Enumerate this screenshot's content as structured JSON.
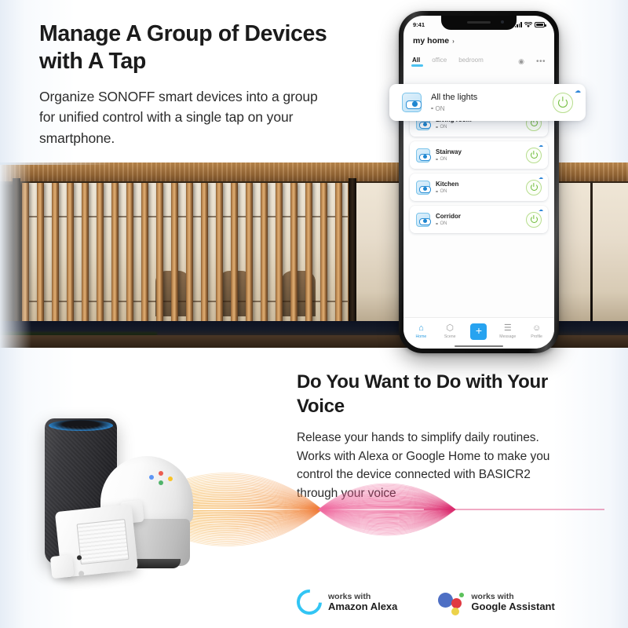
{
  "section1": {
    "heading": "Manage A Group of Devices with A Tap",
    "body": "Organize SONOFF smart devices into a group for unified control with a single tap on your smartphone."
  },
  "phone": {
    "status_bar": {
      "time": "9:41",
      "signal_icon": "signal-bars-icon",
      "wifi_icon": "wifi-icon",
      "battery_icon": "battery-full-icon"
    },
    "home_title": "my home",
    "home_chevron": "›",
    "tabs": [
      {
        "label": "All",
        "active": true
      },
      {
        "label": "office",
        "active": false
      },
      {
        "label": "bedroom",
        "active": false
      }
    ],
    "tab_actions": {
      "eye_icon": "◉",
      "more_icon": "•••"
    },
    "devices": [
      {
        "name": "Living room",
        "state": "ON"
      },
      {
        "name": "Stairway",
        "state": "ON"
      },
      {
        "name": "Kitchen",
        "state": "ON"
      },
      {
        "name": "Corridor",
        "state": "ON"
      }
    ],
    "bottom_nav": [
      {
        "label": "Home",
        "glyph": "⌂",
        "active": true
      },
      {
        "label": "Scene",
        "glyph": "⬡",
        "active": false
      },
      {
        "label": "Add",
        "glyph": "+",
        "active": false
      },
      {
        "label": "Message",
        "glyph": "☰",
        "active": false
      },
      {
        "label": "Profile",
        "glyph": "☺",
        "active": false
      }
    ]
  },
  "float_card": {
    "name": "All the lights",
    "state": "ON",
    "cloud_icon": "☁",
    "toggle_icon": "switch-icon",
    "power_icon": "power-icon"
  },
  "photo": {
    "alt": "modern-house-at-dusk-with-wooden-louvers"
  },
  "section2": {
    "heading": "Do You Want to Do with Your Voice",
    "body": "Release your hands to simplify daily routines. Works with Alexa or Google Home to make you control the device connected with BASICR2 through your voice"
  },
  "badges": [
    {
      "top": "works with",
      "bottom": "Amazon Alexa",
      "icon": "alexa-ring-icon"
    },
    {
      "top": "works with",
      "bottom": "Google Assistant",
      "icon": "google-assistant-dots-icon"
    }
  ],
  "devices_photo": {
    "echo": "amazon-echo-speaker",
    "google_home": "google-home-speaker",
    "sonoff": "sonoff-basicr2-switch"
  },
  "colors": {
    "accent_blue": "#27a3f0",
    "alexa_cyan": "#32c5f4",
    "power_green": "#6fbb3a",
    "google_blue": "#4e6fc4",
    "google_red": "#e03a42",
    "google_green": "#5cc15c",
    "google_yellow": "#ecd24a",
    "wave_green": "#4cbf54",
    "wave_orange": "#f0a63c",
    "wave_pink": "#e23f7e"
  }
}
